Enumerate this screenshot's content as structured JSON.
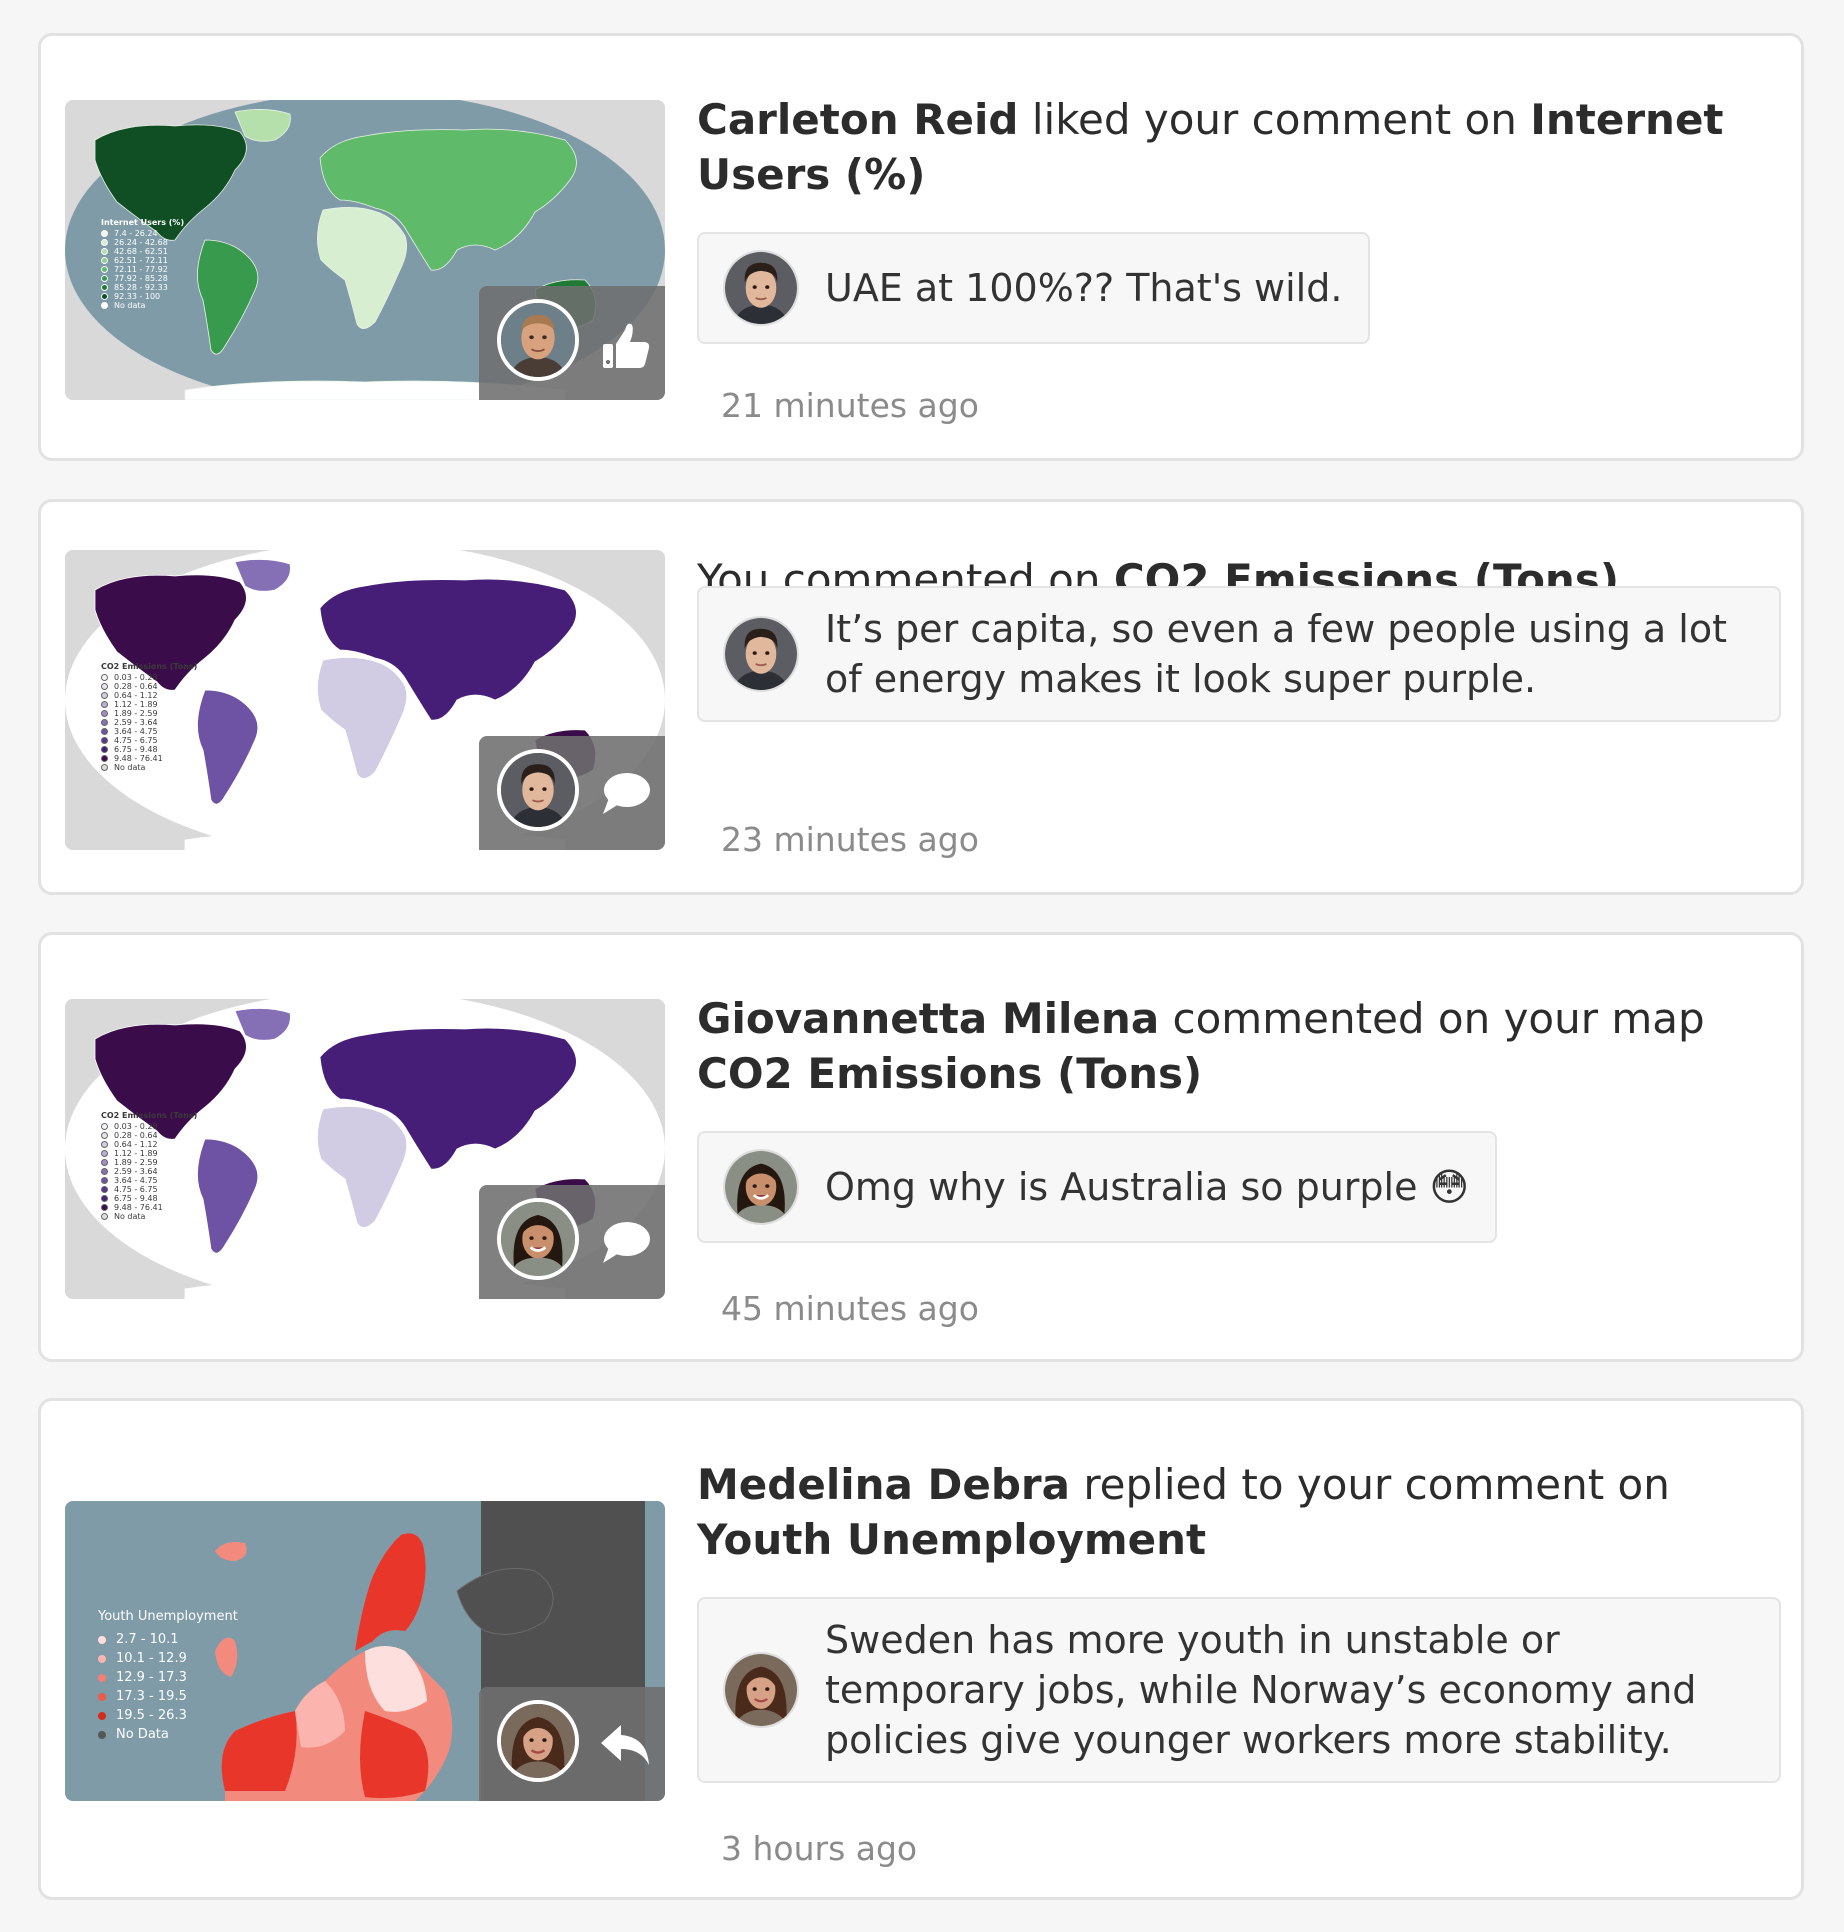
{
  "colors": {
    "background": "#f6f6f6",
    "card": "#ffffff",
    "ocean_internet": "#7f9ba8",
    "co2_dark": "#3b0c4a",
    "youth_red": "#e8372a"
  },
  "notifications": [
    {
      "actor": "Carleton Reid",
      "verb": " liked your comment on ",
      "target": "Internet Users (%)",
      "comment": "UAE at 100%?? That's wild.",
      "time": "21 minutes ago",
      "action_icon": "thumbs-up-icon",
      "map_title": "Internet Users (%)",
      "map_legend": [
        "7.4 - 26.24",
        "26.24 - 42.68",
        "42.68 - 62.51",
        "62.51 - 72.11",
        "72.11 - 77.92",
        "77.92 - 85.28",
        "85.28 - 92.33",
        "92.33 - 100",
        "No data"
      ]
    },
    {
      "actor": "",
      "verb": "You commented on ",
      "target": "CO2 Emissions (Tons)",
      "comment": "It’s per capita, so even a few people using a lot of energy makes it look super purple.",
      "time": "23 minutes ago",
      "action_icon": "speech-bubble-icon",
      "map_title": "CO2 Emissions (Tons)",
      "map_legend": [
        "0.03 - 0.28",
        "0.28 - 0.64",
        "0.64 - 1.12",
        "1.12 - 1.89",
        "1.89 - 2.59",
        "2.59 - 3.64",
        "3.64 - 4.75",
        "4.75 - 6.75",
        "6.75 - 9.48",
        "9.48 - 76.41",
        "No data"
      ]
    },
    {
      "actor": "Giovannetta Milena",
      "verb": " commented on your map ",
      "target": "CO2 Emissions (Tons)",
      "comment": "Omg why is Australia so purple 😳",
      "time": "45 minutes ago",
      "action_icon": "speech-bubble-icon",
      "map_title": "CO2 Emissions (Tons)",
      "map_legend": [
        "0.03 - 0.28",
        "0.28 - 0.64",
        "0.64 - 1.12",
        "1.12 - 1.89",
        "1.89 - 2.59",
        "2.59 - 3.64",
        "3.64 - 4.75",
        "4.75 - 6.75",
        "6.75 - 9.48",
        "9.48 - 76.41",
        "No data"
      ]
    },
    {
      "actor": "Medelina Debra",
      "verb": " replied to your comment on ",
      "target": "Youth Unemployment",
      "comment": "Sweden has more youth in unstable or temporary jobs, while Norway’s economy and policies give younger workers more stability.",
      "time": "3 hours ago",
      "action_icon": "reply-arrow-icon",
      "map_title": "Youth Unemployment",
      "map_legend": [
        "2.7 - 10.1",
        "10.1 - 12.9",
        "12.9 - 17.3",
        "17.3 - 19.5",
        "19.5 - 26.3",
        "No Data"
      ]
    }
  ]
}
